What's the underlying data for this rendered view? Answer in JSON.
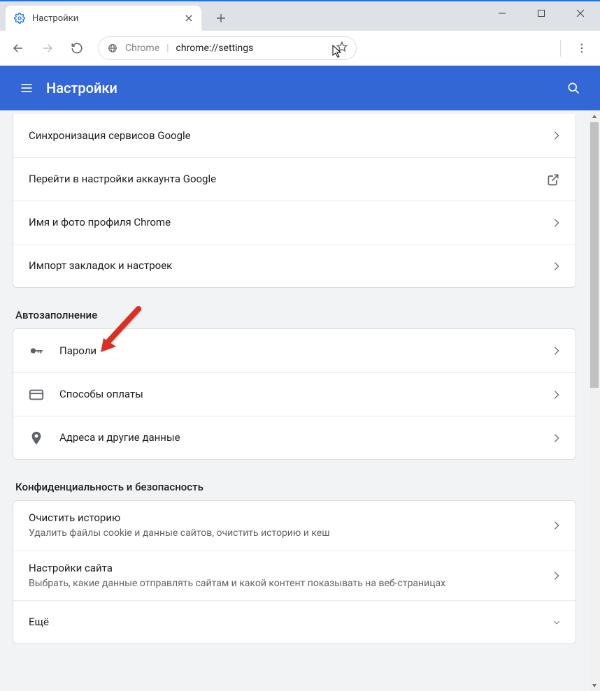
{
  "tab": {
    "title": "Настройки"
  },
  "address": {
    "host": "Chrome",
    "path": "chrome://settings"
  },
  "header": {
    "title": "Настройки"
  },
  "groups": {
    "sync": [
      {
        "title": "Синхронизация сервисов Google",
        "action": "chevron"
      },
      {
        "title": "Перейти в настройки аккаунта Google",
        "action": "external"
      },
      {
        "title": "Имя и фото профиля Chrome",
        "action": "chevron"
      },
      {
        "title": "Импорт закладок и настроек",
        "action": "chevron"
      }
    ],
    "autofill_title": "Автозаполнение",
    "autofill": [
      {
        "icon": "key",
        "title": "Пароли"
      },
      {
        "icon": "card",
        "title": "Способы оплаты"
      },
      {
        "icon": "pin",
        "title": "Адреса и другие данные"
      }
    ],
    "privacy_title": "Конфиденциальность и безопасность",
    "privacy": [
      {
        "title": "Очистить историю",
        "sub": "Удалить файлы cookie и данные сайтов, очистить историю и кеш",
        "action": "chevron"
      },
      {
        "title": "Настройки сайта",
        "sub": "Выбрать, какие данные отправлять сайтам и какой контент показывать на веб-страницах",
        "action": "chevron"
      },
      {
        "title": "Ещё",
        "action": "expand"
      }
    ]
  },
  "colors": {
    "accent": "#3367d6",
    "annotation": "#d93025"
  }
}
